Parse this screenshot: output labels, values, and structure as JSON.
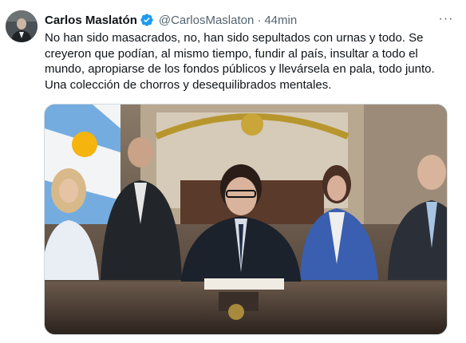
{
  "tweet": {
    "author_name": "Carlos Maslatón",
    "handle": "@CarlosMaslaton",
    "separator": "·",
    "time": "44min",
    "more_label": "···",
    "text": "No han sido masacrados, no, han sido sepultados con urnas y todo. Se creyeron que podían, al mismo tiempo, fundir al país, insultar a todo el mundo, apropiarse de los fondos públicos y llevársela en pala, todo junto. Una colección de chorros y desequilibrados mentales.",
    "verified_icon": "verified-badge-icon",
    "colors": {
      "verified_blue": "#1d9bf0",
      "secondary_text": "#536471",
      "primary_text": "#0f1419"
    }
  }
}
